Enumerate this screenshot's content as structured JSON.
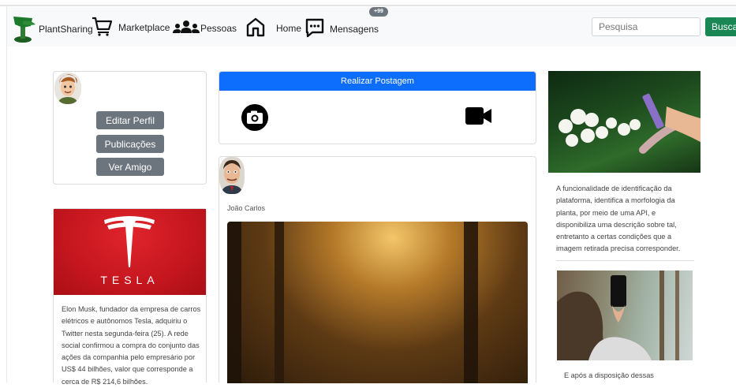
{
  "navbar": {
    "brand": "PlantSharing",
    "items": [
      {
        "label": "Marketplace",
        "icon": "cart-icon"
      },
      {
        "label": "Pessoas",
        "icon": "people-icon"
      },
      {
        "label": "Home",
        "icon": "home-icon"
      },
      {
        "label": "Mensagens",
        "icon": "chat-icon"
      }
    ],
    "badge": "+99",
    "search": {
      "placeholder": "Pesquisa",
      "button": "Busca"
    }
  },
  "profile": {
    "buttons": [
      "Editar Perfil",
      "Publicações",
      "Ver Amigo"
    ]
  },
  "ad": {
    "logo_text": "TESLA",
    "text": "Elon Musk, fundador da empresa de carros elétricos e autônomos Tesla, adquiriu o Twitter nesta segunda-feira (25). A rede social confirmou a compra do conjunto das ações da companhia pelo empresário por US$ 44 bilhões, valor que corresponde a cerca de R$ 214,6 bilhões."
  },
  "post_box": {
    "button": "Realizar Postagem",
    "photo_icon": "camera-icon",
    "video_icon": "video-icon"
  },
  "feed": {
    "author": "João Carlos"
  },
  "sidebar_right": {
    "text1": "A funcionalidade de identificação da plataforma, identifica a morfologia da planta, por meio de uma API, e disponibiliza uma descrição sobre tal, entretanto a certas condições que a imagem retirada precisa corresponder.",
    "text2": "E após a disposição dessas"
  },
  "colors": {
    "primary": "#0d6efd",
    "secondary": "#6c757d",
    "success": "#198754",
    "navbar_bg": "#f8f9fa",
    "tesla_red": "#c4161e"
  }
}
